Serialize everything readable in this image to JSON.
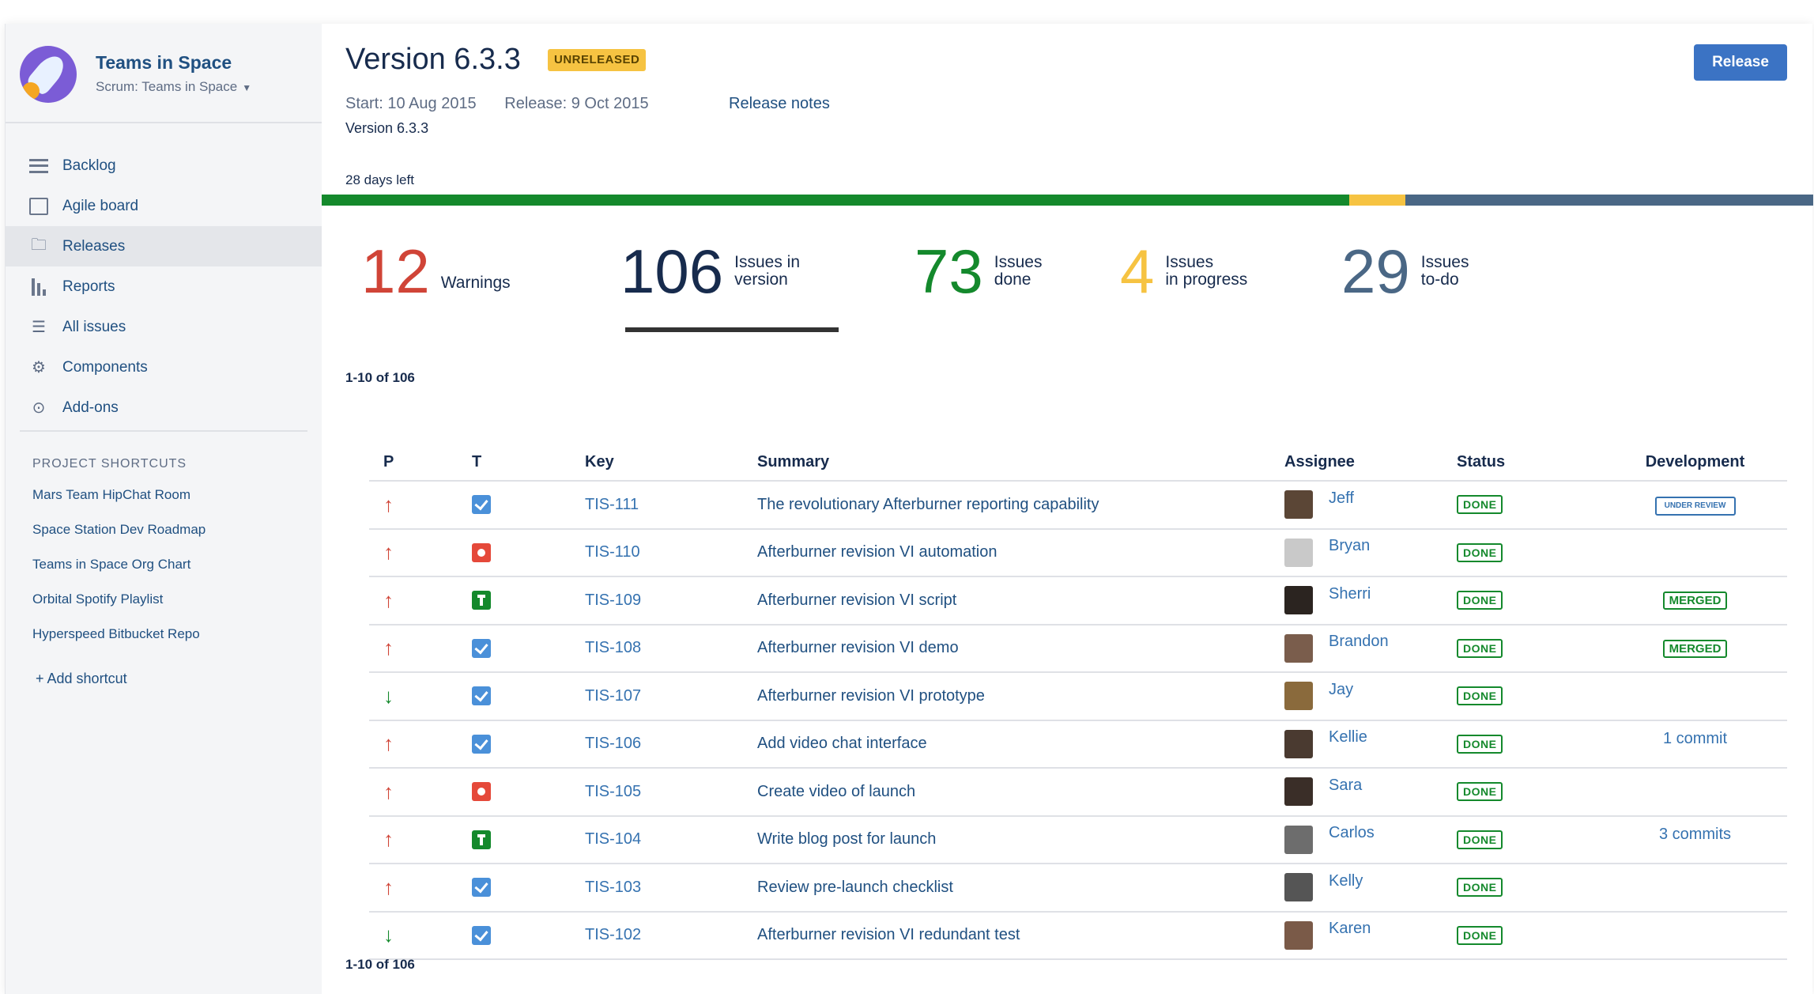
{
  "sidebar": {
    "project_name": "Teams in Space",
    "project_sub": "Scrum: Teams in Space",
    "nav": [
      {
        "label": "Backlog",
        "icon": "backlog-icon"
      },
      {
        "label": "Agile board",
        "icon": "board-icon"
      },
      {
        "label": "Releases",
        "icon": "releases-icon",
        "active": true
      },
      {
        "label": "Reports",
        "icon": "reports-icon"
      },
      {
        "label": "All issues",
        "icon": "issues-icon"
      },
      {
        "label": "Components",
        "icon": "components-icon"
      },
      {
        "label": "Add-ons",
        "icon": "addons-icon"
      }
    ],
    "shortcuts_title": "PROJECT SHORTCUTS",
    "shortcuts": [
      "Mars Team HipChat Room",
      "Space Station Dev Roadmap",
      "Teams in Space Org Chart",
      "Orbital Spotify Playlist",
      "Hyperspeed Bitbucket Repo"
    ],
    "add_shortcut": "+ Add shortcut"
  },
  "header": {
    "title": "Version 6.3.3",
    "lozenge": "UNRELEASED",
    "release_button": "Release",
    "start": "Start: 10 Aug 2015",
    "release_date": "Release: 9 Oct 2015",
    "release_notes": "Release notes",
    "description": "Version 6.3.3",
    "days_left": "28 days left"
  },
  "progress": {
    "done": 73,
    "in_progress": 4,
    "todo": 29,
    "total": 106,
    "colors": {
      "done": "#14892c",
      "in_progress": "#f6c342",
      "todo": "#4a6785"
    }
  },
  "stats": {
    "warnings": {
      "num": "12",
      "label1": "Warnings",
      "label2": "",
      "color": "#d04437"
    },
    "in_version": {
      "num": "106",
      "label1": "Issues in",
      "label2": "version",
      "color": "#172b4d"
    },
    "done": {
      "num": "73",
      "label1": "Issues",
      "label2": "done",
      "color": "#14892c"
    },
    "in_progress": {
      "num": "4",
      "label1": "Issues",
      "label2": "in progress",
      "color": "#f6c342"
    },
    "todo": {
      "num": "29",
      "label1": "Issues",
      "label2": "to-do",
      "color": "#4a6785"
    }
  },
  "count_top": "1-10 of 106",
  "count_bottom": "1-10 of 106",
  "table": {
    "headers": {
      "p": "P",
      "t": "T",
      "key": "Key",
      "summary": "Summary",
      "assignee": "Assignee",
      "status": "Status",
      "development": "Development"
    },
    "rows": [
      {
        "priority": "up",
        "type": "task",
        "key": "TIS-111",
        "summary": "The revolutionary Afterburner reporting capability",
        "assignee": "Jeff",
        "status": "DONE",
        "dev": "UNDER REVIEW",
        "dev_kind": "review"
      },
      {
        "priority": "up",
        "type": "bug",
        "key": "TIS-110",
        "summary": "Afterburner revision VI automation",
        "assignee": "Bryan",
        "status": "DONE",
        "dev": "",
        "dev_kind": "none"
      },
      {
        "priority": "up",
        "type": "story",
        "key": "TIS-109",
        "summary": "Afterburner revision VI script",
        "assignee": "Sherri",
        "status": "DONE",
        "dev": "MERGED",
        "dev_kind": "merged"
      },
      {
        "priority": "up",
        "type": "task",
        "key": "TIS-108",
        "summary": "Afterburner revision VI demo",
        "assignee": "Brandon",
        "status": "DONE",
        "dev": "MERGED",
        "dev_kind": "merged"
      },
      {
        "priority": "down",
        "type": "task",
        "key": "TIS-107",
        "summary": "Afterburner revision VI prototype",
        "assignee": "Jay",
        "status": "DONE",
        "dev": "",
        "dev_kind": "none"
      },
      {
        "priority": "up",
        "type": "task",
        "key": "TIS-106",
        "summary": "Add video chat interface",
        "assignee": "Kellie",
        "status": "DONE",
        "dev": "1 commit",
        "dev_kind": "commit"
      },
      {
        "priority": "up",
        "type": "bug",
        "key": "TIS-105",
        "summary": "Create video of launch",
        "assignee": "Sara",
        "status": "DONE",
        "dev": "",
        "dev_kind": "none"
      },
      {
        "priority": "up",
        "type": "story",
        "key": "TIS-104",
        "summary": "Write blog post for launch",
        "assignee": "Carlos",
        "status": "DONE",
        "dev": "3 commits",
        "dev_kind": "commit"
      },
      {
        "priority": "up",
        "type": "task",
        "key": "TIS-103",
        "summary": "Review pre-launch checklist",
        "assignee": "Kelly",
        "status": "DONE",
        "dev": "",
        "dev_kind": "none"
      },
      {
        "priority": "down",
        "type": "task",
        "key": "TIS-102",
        "summary": "Afterburner revision VI redundant test",
        "assignee": "Karen",
        "status": "DONE",
        "dev": "",
        "dev_kind": "none"
      }
    ]
  }
}
